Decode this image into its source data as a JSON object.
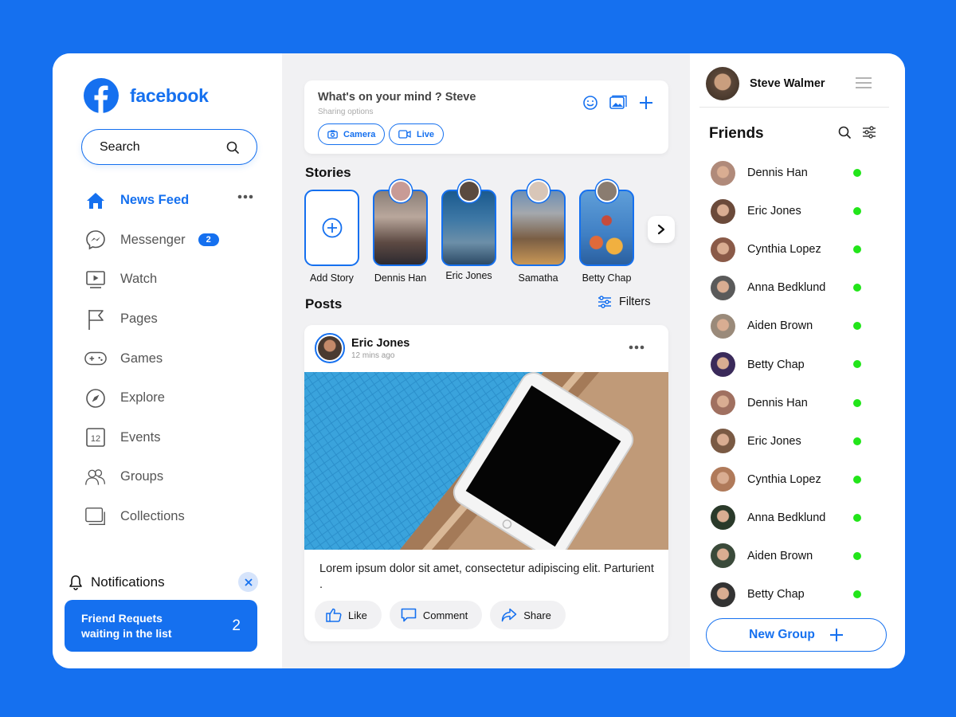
{
  "colors": {
    "accent": "#1570ef",
    "online": "#22e51a",
    "background": "#1570ef"
  },
  "brand": {
    "name": "facebook",
    "icon": "facebook-logo-icon"
  },
  "search": {
    "label": "Search",
    "icon": "search-icon"
  },
  "nav": {
    "items": [
      {
        "label": "News Feed",
        "icon": "home-icon",
        "active": true
      },
      {
        "label": "Messenger",
        "icon": "messenger-icon",
        "badge": "2"
      },
      {
        "label": "Watch",
        "icon": "watch-icon"
      },
      {
        "label": "Pages",
        "icon": "flag-icon"
      },
      {
        "label": "Games",
        "icon": "gamepad-icon"
      },
      {
        "label": "Explore",
        "icon": "compass-icon"
      },
      {
        "label": "Events",
        "icon": "calendar-icon",
        "icon_text": "12"
      },
      {
        "label": "Groups",
        "icon": "groups-icon"
      },
      {
        "label": "Collections",
        "icon": "collections-icon"
      }
    ]
  },
  "notifications": {
    "label": "Notifications",
    "card_text": "Friend Requets waiting in the list",
    "card_line1": "Friend Requets",
    "card_line2": "waiting in the list",
    "count": "2"
  },
  "composer": {
    "prompt": "What's on your mind ?  Steve",
    "sub": "Sharing options",
    "camera": "Camera",
    "live": "Live"
  },
  "stories": {
    "title": "Stories",
    "items": [
      {
        "label": "Add Story"
      },
      {
        "label": "Dennis Han"
      },
      {
        "label": "Eric Jones"
      },
      {
        "label": "Samatha"
      },
      {
        "label": "Betty Chap"
      }
    ]
  },
  "posts": {
    "title": "Posts",
    "filters": "Filters",
    "post": {
      "author": "Eric Jones",
      "time": "12 mins ago",
      "text": "Lorem ipsum dolor sit amet, consectetur adipiscing elit. Parturient .",
      "like": "Like",
      "comment": "Comment",
      "share": "Share"
    }
  },
  "profile": {
    "name": "Steve Walmer"
  },
  "friends": {
    "title": "Friends",
    "list": [
      {
        "name": "Dennis Han",
        "color": "#b08a7a"
      },
      {
        "name": "Eric Jones",
        "color": "#6b4a3a"
      },
      {
        "name": "Cynthia Lopez",
        "color": "#8a5a48"
      },
      {
        "name": "Anna Bedklund",
        "color": "#5a5a5a"
      },
      {
        "name": "Aiden Brown",
        "color": "#9a8a7a"
      },
      {
        "name": "Betty Chap",
        "color": "#3a2a5a"
      },
      {
        "name": "Dennis Han",
        "color": "#a07060"
      },
      {
        "name": "Eric Jones",
        "color": "#7a5a44"
      },
      {
        "name": "Cynthia Lopez",
        "color": "#b07a5a"
      },
      {
        "name": "Anna Bedklund",
        "color": "#2a3a2a"
      },
      {
        "name": "Aiden Brown",
        "color": "#3a4a3a"
      },
      {
        "name": "Betty Chap",
        "color": "#333333"
      }
    ],
    "new_group": "New Group"
  }
}
